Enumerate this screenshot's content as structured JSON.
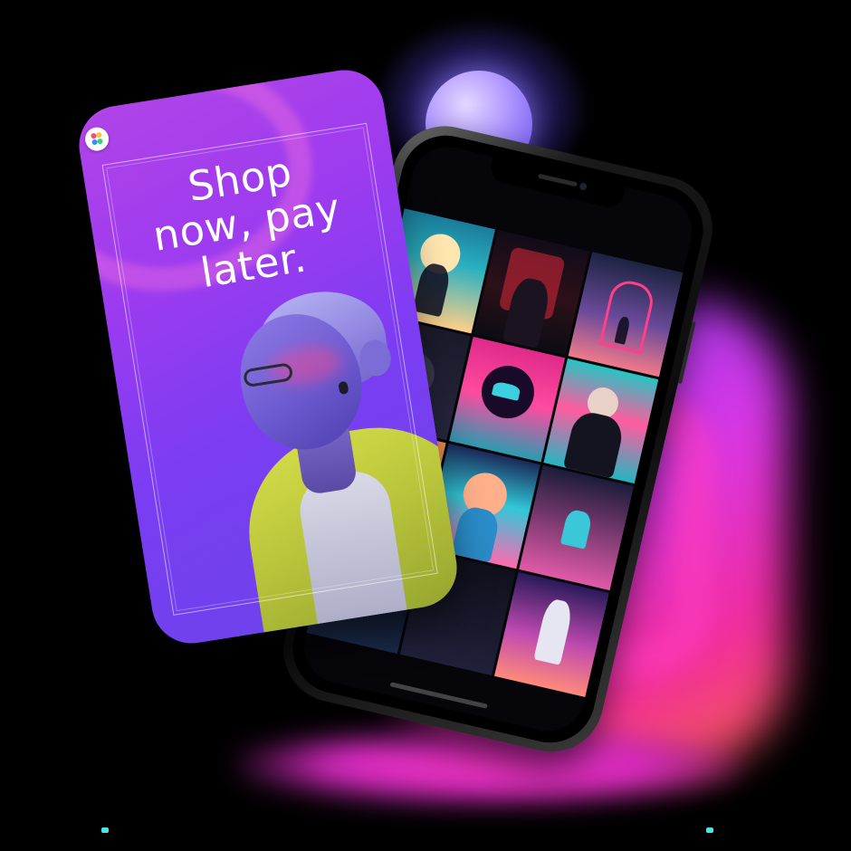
{
  "story_card": {
    "headline_lines": [
      "Shop",
      "now, pay",
      "later."
    ],
    "colors": {
      "gradient_start": "#b044e8",
      "gradient_end": "#6a44ea",
      "text": "#ffffff"
    },
    "logo_icon": "colorful-dots-logo-icon",
    "image": "person-with-glasses-yellow-jacket"
  },
  "phone": {
    "model_shape": "notched-smartphone",
    "screen_content": "poster-art-grid",
    "grid_tiles": [
      "bird-over-afro-figure-poster",
      "red-glitch-portrait-poster",
      "figure-under-arch-sunset-poster",
      "dark-moody-poster",
      "hand-with-bird-poster",
      "bald-man-jacket-poster",
      "orange-sunset-poster",
      "curly-hair-glasses-portrait-poster",
      "hand-reaching-poster",
      "dark-minimal-poster",
      "dark-night-poster",
      "astronaut-floating-poster"
    ]
  },
  "background": {
    "orb_color": "#a58cff",
    "glow_colors": [
      "#8a3cff",
      "#e53af0",
      "#ff2fa6",
      "#ff6a4a"
    ]
  }
}
